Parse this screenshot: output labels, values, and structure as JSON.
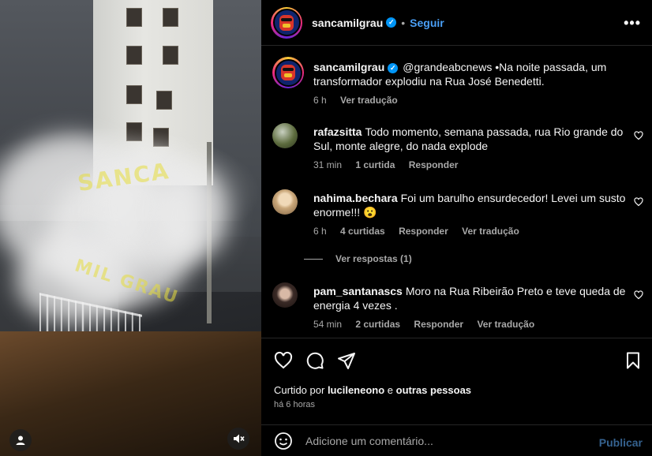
{
  "post": {
    "author": "sancamilgrau",
    "follow_label": "Seguir",
    "dot": "•",
    "more_glyph": "•••",
    "caption": "@grandeabcnews •Na noite passada, um transformador explodiu na Rua José Benedetti.",
    "caption_time": "6 h",
    "caption_translate": "Ver tradução",
    "watermark_top": "SANCA",
    "watermark_bottom": "MIL GRAU"
  },
  "comments": [
    {
      "user": "rafazsitta",
      "text": "Todo momento, semana passada, rua Rio grande do Sul, monte alegre, do nada explode",
      "time": "31 min",
      "likes": "1 curtida",
      "reply": "Responder",
      "translate": "",
      "avatar_color": "#5c6b3d"
    },
    {
      "user": "nahima.bechara",
      "text": "Foi um barulho ensurdecedor! Levei um susto enorme!!! 😮",
      "time": "6 h",
      "likes": "4 curtidas",
      "reply": "Responder",
      "translate": "Ver tradução",
      "avatar_color": "#c9a77a",
      "view_replies": "Ver respostas (1)"
    },
    {
      "user": "pam_santanascs",
      "text": "Moro na Rua Ribeirão Preto e teve queda de energia 4 vezes .",
      "time": "54 min",
      "likes": "2 curtidas",
      "reply": "Responder",
      "translate": "Ver tradução",
      "avatar_color": "#3a2a26"
    }
  ],
  "actions": {
    "liked_by_prefix": "Curtido por",
    "liked_by_user": "lucileneono",
    "liked_by_and": "e",
    "liked_by_others": "outras pessoas",
    "posted_ago": "há 6 horas"
  },
  "composer": {
    "placeholder": "Adicione um comentário...",
    "publish_label": "Publicar"
  },
  "colors": {
    "accent": "#0095f6",
    "follow": "#4a9ff5",
    "publish_disabled": "#35628f",
    "muted": "#a8a8a8"
  },
  "icons": {
    "media_profile": "user-icon",
    "media_mute": "speaker-muted-icon",
    "like": "heart-icon",
    "comment": "comment-icon",
    "share": "send-icon",
    "save": "bookmark-icon",
    "emoji": "emoji-icon"
  }
}
